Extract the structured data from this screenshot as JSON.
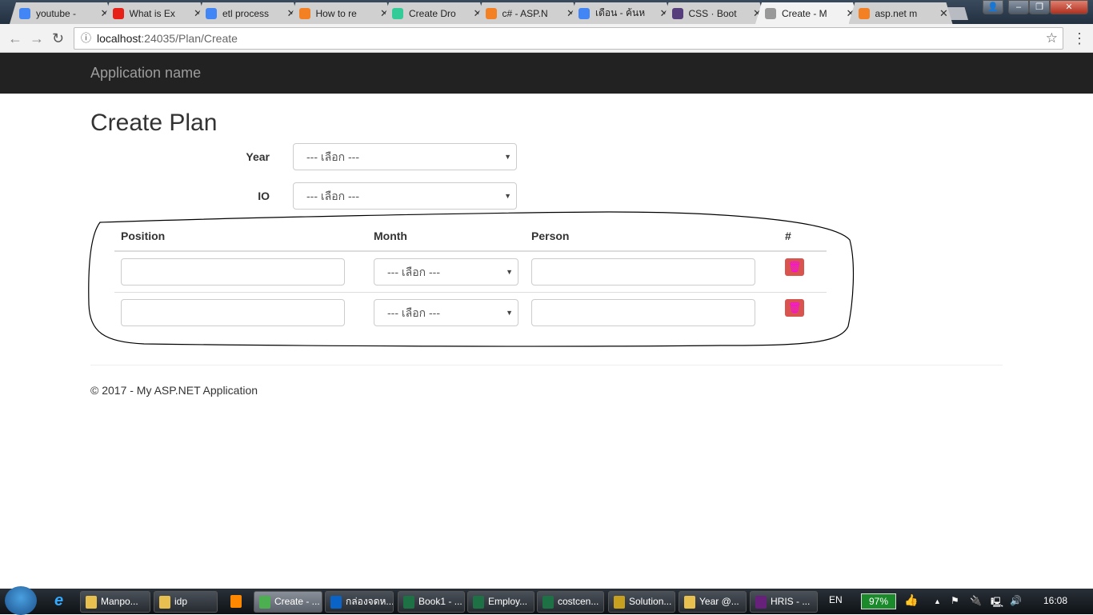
{
  "browser": {
    "tabs": [
      {
        "label": "youtube -",
        "icon": "google-icon",
        "color": "#4285f4"
      },
      {
        "label": "What is Ex",
        "icon": "youtube-icon",
        "color": "#e62117"
      },
      {
        "label": "etl process",
        "icon": "google-icon",
        "color": "#4285f4"
      },
      {
        "label": "How to re",
        "icon": "stackoverflow-icon",
        "color": "#f48024"
      },
      {
        "label": "Create Dro",
        "icon": "colorful-logo-icon",
        "color": "#3c9"
      },
      {
        "label": "c# - ASP.N",
        "icon": "stackoverflow-icon",
        "color": "#f48024"
      },
      {
        "label": "เดือน - ค้นห",
        "icon": "google-icon",
        "color": "#4285f4"
      },
      {
        "label": "CSS · Boot",
        "icon": "bootstrap-icon",
        "color": "#563d7c"
      },
      {
        "label": "Create - M",
        "icon": "page-icon",
        "color": "#999",
        "active": true
      },
      {
        "label": "asp.net m",
        "icon": "stackoverflow-icon",
        "color": "#f48024"
      }
    ],
    "url_host": "localhost",
    "url_path": ":24035/Plan/Create"
  },
  "navbar": {
    "brand": "Application name"
  },
  "page": {
    "title": "Create Plan",
    "year_label": "Year",
    "year_value": "--- เลือก ---",
    "io_label": "IO",
    "io_value": "--- เลือก ---",
    "table": {
      "headers": [
        "Position",
        "Month",
        "Person",
        "#"
      ],
      "rows": [
        {
          "position": "",
          "month": "--- เลือก ---",
          "person": ""
        },
        {
          "position": "",
          "month": "--- เลือก ---",
          "person": ""
        }
      ]
    },
    "footer": "© 2017 - My ASP.NET Application"
  },
  "taskbar": {
    "items": [
      {
        "label": "Manpo...",
        "color": "#e8c050"
      },
      {
        "label": "idp",
        "color": "#e8c050"
      },
      {
        "label": "Create - ...",
        "color": "#4caf50",
        "active": true
      },
      {
        "label": "กล่องจดห...",
        "color": "#0a64c8"
      },
      {
        "label": "Book1 - ...",
        "color": "#1e7145"
      },
      {
        "label": "Employ...",
        "color": "#1e7145"
      },
      {
        "label": "costcen...",
        "color": "#1e7145"
      },
      {
        "label": "Solution...",
        "color": "#c8a020"
      },
      {
        "label": "Year @...",
        "color": "#e8c050"
      },
      {
        "label": "HRIS - ...",
        "color": "#68217a"
      }
    ],
    "lang": "EN",
    "battery": "97%",
    "time": "16:08"
  },
  "colors": {
    "danger": "#d9534f",
    "navbar": "#222222"
  }
}
